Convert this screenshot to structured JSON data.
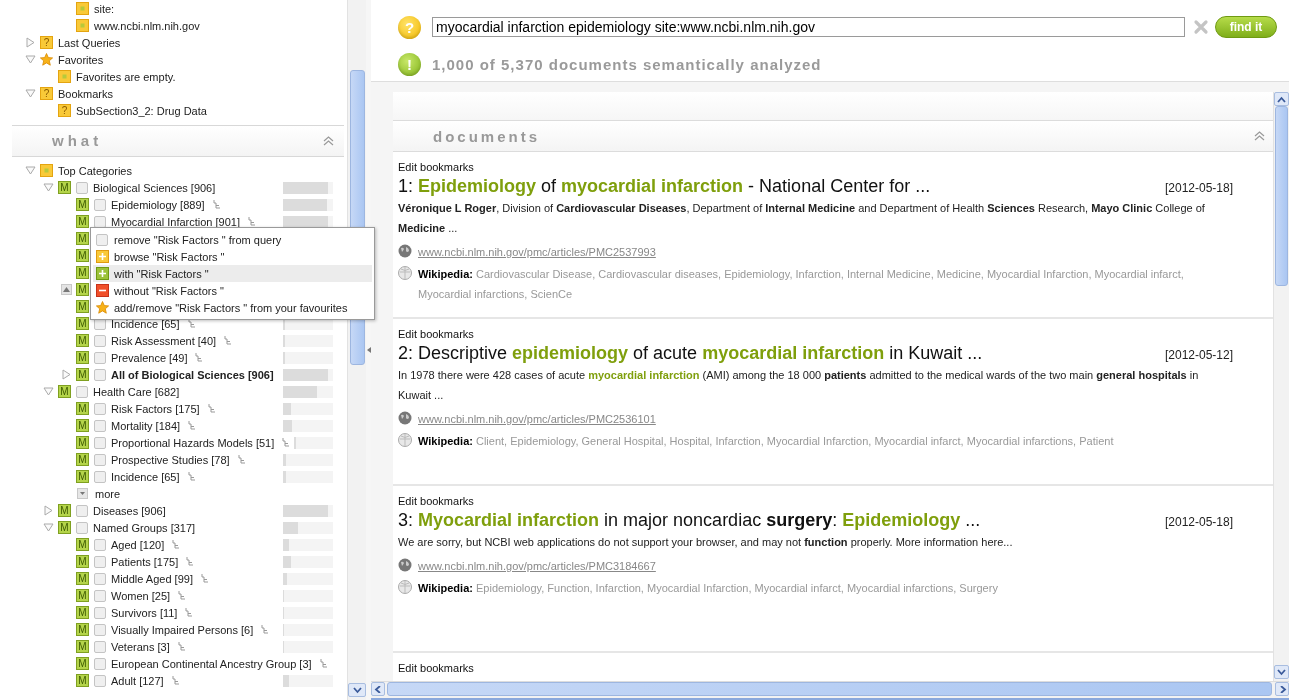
{
  "sidebar": {
    "query_terms": [
      {
        "label": "site:",
        "kind": "note"
      },
      {
        "label": "www.ncbi.nlm.nih.gov",
        "kind": "note"
      }
    ],
    "sections": [
      {
        "label": "Last Queries",
        "kind": "query",
        "badge": "?",
        "expanded": false
      },
      {
        "label": "Favorites",
        "kind": "star",
        "expanded": true,
        "children": [
          {
            "label": "Favorites are empty.",
            "kind": "note"
          }
        ]
      },
      {
        "label": "Bookmarks",
        "kind": "query",
        "badge": "?",
        "expanded": true,
        "children": [
          {
            "label": "SubSection3_2: Drug Data",
            "kind": "query",
            "badge": "?"
          }
        ]
      }
    ],
    "what": {
      "title": "what"
    },
    "categories": {
      "label": "Top Categories",
      "kind": "note",
      "expanded": true,
      "children": [
        {
          "label": "Biological Sciences [906]",
          "kind": "mesh",
          "badge": "M",
          "checked": false,
          "level": 0.9,
          "expanded": true,
          "children": [
            {
              "label": "Epidemiology [889]",
              "kind": "mesh",
              "badge": "M",
              "checked": false,
              "branch": true,
              "level": 0.88
            },
            {
              "label": "Myocardial Infarction [901]",
              "kind": "mesh",
              "badge": "M",
              "checked": false,
              "branch": true,
              "level": 0.9
            },
            {
              "kind": "mesh",
              "badge": "M"
            },
            {
              "kind": "mesh",
              "badge": "M"
            },
            {
              "kind": "mesh",
              "badge": "M"
            },
            {
              "kind": "mesh",
              "badge": "M",
              "collapse_button": true
            },
            {
              "kind": "mesh",
              "badge": "M"
            },
            {
              "label": "Incidence [65]",
              "kind": "mesh",
              "badge": "M",
              "checked": false,
              "branch": true,
              "level": 0.04
            },
            {
              "label": "Risk Assessment [40]",
              "kind": "mesh",
              "badge": "M",
              "checked": false,
              "branch": true,
              "level": 0.03
            },
            {
              "label": "Prevalence [49]",
              "kind": "mesh",
              "badge": "M",
              "checked": false,
              "branch": true,
              "level": 0.03
            },
            {
              "label": "All of Biological Sciences [906]",
              "kind": "mesh",
              "badge": "M",
              "checked": false,
              "bold": true,
              "expanded": false,
              "level": 0.9
            }
          ]
        },
        {
          "label": "Health Care [682]",
          "kind": "mesh",
          "badge": "M",
          "checked": false,
          "level": 0.68,
          "expanded": true,
          "children": [
            {
              "label": "Risk Factors [175]",
              "kind": "mesh",
              "badge": "M",
              "checked": false,
              "branch": true,
              "level": 0.16
            },
            {
              "label": "Mortality [184]",
              "kind": "mesh",
              "badge": "M",
              "checked": false,
              "branch": true,
              "level": 0.18
            },
            {
              "label": "Proportional Hazards Models [51]",
              "kind": "mesh",
              "badge": "M",
              "checked": false,
              "branch": true,
              "level": 0.05
            },
            {
              "label": "Prospective Studies [78]",
              "kind": "mesh",
              "badge": "M",
              "checked": false,
              "branch": true,
              "level": 0.06
            },
            {
              "label": "Incidence [65]",
              "kind": "mesh",
              "badge": "M",
              "checked": false,
              "branch": true,
              "level": 0.05
            },
            {
              "label": "more",
              "kind": "more"
            }
          ]
        },
        {
          "label": "Diseases [906]",
          "kind": "mesh",
          "badge": "M",
          "checked": false,
          "level": 0.9,
          "expanded": false
        },
        {
          "label": "Named Groups [317]",
          "kind": "mesh",
          "badge": "M",
          "checked": false,
          "level": 0.3,
          "expanded": true,
          "children": [
            {
              "label": "Aged [120]",
              "kind": "mesh",
              "badge": "M",
              "checked": false,
              "branch": true,
              "level": 0.12
            },
            {
              "label": "Patients [175]",
              "kind": "mesh",
              "badge": "M",
              "checked": false,
              "branch": true,
              "level": 0.16
            },
            {
              "label": "Middle Aged [99]",
              "kind": "mesh",
              "badge": "M",
              "checked": false,
              "branch": true,
              "level": 0.08
            },
            {
              "label": "Women [25]",
              "kind": "mesh",
              "badge": "M",
              "checked": false,
              "branch": true,
              "level": 0.02
            },
            {
              "label": "Survivors [11]",
              "kind": "mesh",
              "badge": "M",
              "checked": false,
              "branch": true,
              "level": 0.01
            },
            {
              "label": "Visually Impaired Persons [6]",
              "kind": "mesh",
              "badge": "M",
              "checked": false,
              "branch": true,
              "level": 0.01
            },
            {
              "label": "Veterans [3]",
              "kind": "mesh",
              "badge": "M",
              "checked": false,
              "branch": true,
              "level": 0.01
            },
            {
              "label": "European Continental Ancestry Group [3]",
              "kind": "mesh",
              "badge": "M",
              "checked": false,
              "branch": true
            },
            {
              "label": "Adult [127]",
              "kind": "mesh",
              "badge": "M",
              "checked": false,
              "branch": true,
              "level": 0.12
            }
          ]
        }
      ]
    }
  },
  "context_menu": {
    "items": [
      {
        "kind": "remove",
        "label": "remove \"Risk Factors \" from query",
        "selected": false
      },
      {
        "kind": "browse",
        "label": "browse \"Risk Factors \"",
        "selected": false
      },
      {
        "kind": "with",
        "label": "with \"Risk Factors \"",
        "selected": true
      },
      {
        "kind": "without",
        "label": "without \"Risk Factors \"",
        "selected": false
      },
      {
        "kind": "favourite",
        "label": "add/remove \"Risk Factors \" from your favourites",
        "selected": false
      }
    ]
  },
  "search": {
    "badge": "?",
    "value": "myocardial infarction epidemiology site:www.ncbi.nlm.nih.gov",
    "button": "find it"
  },
  "status": {
    "badge": "!",
    "text": "1,000 of 5,370 documents semantically analyzed"
  },
  "documents": {
    "title": "documents",
    "results": [
      {
        "edit": "Edit bookmarks",
        "date": "[2012-05-18]",
        "title": [
          {
            "kind": "plain",
            "text": "1: "
          },
          {
            "kind": "hit",
            "text": "Epidemiology"
          },
          {
            "kind": "plain",
            "text": " of "
          },
          {
            "kind": "hit",
            "text": "myocardial infarction"
          },
          {
            "kind": "plain",
            "text": " - National Center for ..."
          }
        ],
        "snippet": [
          {
            "kind": "plain",
            "text": "**Véronique L Roger**, Division of **Cardiovascular Diseases**, Department of **Internal Medicine** and Department of Health **Sciences** Research, **Mayo Clinic** College of **Medicine** ..."
          }
        ],
        "url": "www.ncbi.nlm.nih.gov/pmc/articles/PMC2537993",
        "wiki_label": "Wikipedia:",
        "wiki_terms": "Cardiovascular Disease, Cardiovascular diseases, Epidemiology, Infarction, Internal Medicine, Medicine, Myocardial Infarction, Myocardial infarct, Myocardial infarctions, ScienCe"
      },
      {
        "edit": "Edit bookmarks",
        "date": "[2012-05-12]",
        "title": [
          {
            "kind": "plain",
            "text": "2: Descriptive "
          },
          {
            "kind": "hit",
            "text": "epidemiology"
          },
          {
            "kind": "plain",
            "text": " of acute "
          },
          {
            "kind": "hit",
            "text": "myocardial infarction"
          },
          {
            "kind": "plain",
            "text": " in Kuwait ..."
          }
        ],
        "snippet": [
          {
            "kind": "plain",
            "text": "In 1978 there were 428 cases of acute "
          },
          {
            "kind": "hit",
            "text": "myocardial infarction"
          },
          {
            "kind": "plain",
            "text": " (AMI) among the 18 000 **patients** admitted to the medical wards of the two main **general hospitals** in Kuwait ..."
          }
        ],
        "url": "www.ncbi.nlm.nih.gov/pmc/articles/PMC2536101",
        "wiki_label": "Wikipedia:",
        "wiki_terms": "Client, Epidemiology, General Hospital, Hospital, Infarction, Myocardial Infarction, Myocardial infarct, Myocardial infarctions, Patient"
      },
      {
        "edit": "Edit bookmarks",
        "date": "[2012-05-18]",
        "title": [
          {
            "kind": "plain",
            "text": "3: "
          },
          {
            "kind": "hit",
            "text": "Myocardial infarction"
          },
          {
            "kind": "plain",
            "text": " in major noncardiac **surgery**: "
          },
          {
            "kind": "hit",
            "text": "Epidemiology"
          },
          {
            "kind": "plain",
            "text": " ..."
          }
        ],
        "snippet": [
          {
            "kind": "plain",
            "text": "We are sorry, but NCBI web applications do not support your browser, and may not **function** properly. More information here..."
          }
        ],
        "url": "www.ncbi.nlm.nih.gov/pmc/articles/PMC3184667",
        "wiki_label": "Wikipedia:",
        "wiki_terms": "Epidemiology, Function, Infarction, Myocardial Infarction, Myocardial infarct, Myocardial infarctions, Surgery"
      },
      {
        "edit": "Edit bookmarks"
      }
    ]
  }
}
